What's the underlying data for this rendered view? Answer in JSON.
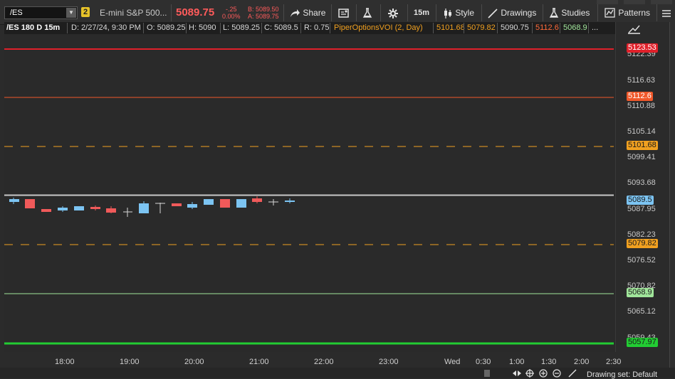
{
  "header": {
    "symbol": "/ES",
    "link_group": "2",
    "description": "E-mini S&P 500...",
    "last_price": "5089.75",
    "net_change": "-.25",
    "percent_change": "0.00%",
    "bid": "B: 5089.50",
    "ask": "A: 5089.75",
    "share_label": "Share",
    "timeframe_label": "15m",
    "style_label": "Style",
    "drawings_label": "Drawings",
    "studies_label": "Studies",
    "patterns_label": "Patterns"
  },
  "infobar": {
    "symbol": "/ES 180 D 15m",
    "date": "D: 2/27/24, 9:30 PM",
    "open": "O: 5089.25",
    "high": "H: 5090",
    "low": "L: 5089.25",
    "close": "C: 5089.5",
    "range": "R: 0.75",
    "study_name": "PiperOptionsVOI (2, Day)",
    "study_values": [
      "5101.68",
      "5079.82",
      "5090.75",
      "5112.6",
      "5068.9"
    ],
    "more": "..."
  },
  "price_axis": {
    "ticks": [
      "5122.39",
      "5116.63",
      "5110.88",
      "5105.14",
      "5099.41",
      "5093.68",
      "5087.95",
      "5082.23",
      "5076.52",
      "5070.82",
      "5065.12",
      "5059.43"
    ],
    "labels": [
      {
        "value": "5123.53",
        "bg": "#e0202a",
        "fg": "#ffffff"
      },
      {
        "value": "5112.6",
        "bg": "#f0582a",
        "fg": "#ffffff"
      },
      {
        "value": "5101.68",
        "bg": "#f0a020",
        "fg": "#1a1a1a"
      },
      {
        "value": "5089.5",
        "bg": "#7cc4f2",
        "fg": "#1a1a1a"
      },
      {
        "value": "5079.82",
        "bg": "#f0a020",
        "fg": "#1a1a1a"
      },
      {
        "value": "5068.9",
        "bg": "#a0e59a",
        "fg": "#1a1a1a"
      },
      {
        "value": "5057.97",
        "bg": "#22cc33",
        "fg": "#1a1a1a"
      }
    ]
  },
  "time_axis": {
    "labels": [
      "18:00",
      "19:00",
      "20:00",
      "21:00",
      "22:00",
      "23:00",
      "Wed",
      "0:30",
      "1:00",
      "1:30",
      "2:00",
      "2:30"
    ]
  },
  "footer": {
    "drawing_set": "Drawing set: Default"
  },
  "colors": {
    "up": "#7cc4f2",
    "down": "#f05a5a",
    "level_red": "#e0202a",
    "level_orange": "#f0582a",
    "level_dash": "#f0a020",
    "level_lightgreen": "#a0e59a",
    "level_green": "#22cc33",
    "last_line": "#c8c8c8"
  }
}
